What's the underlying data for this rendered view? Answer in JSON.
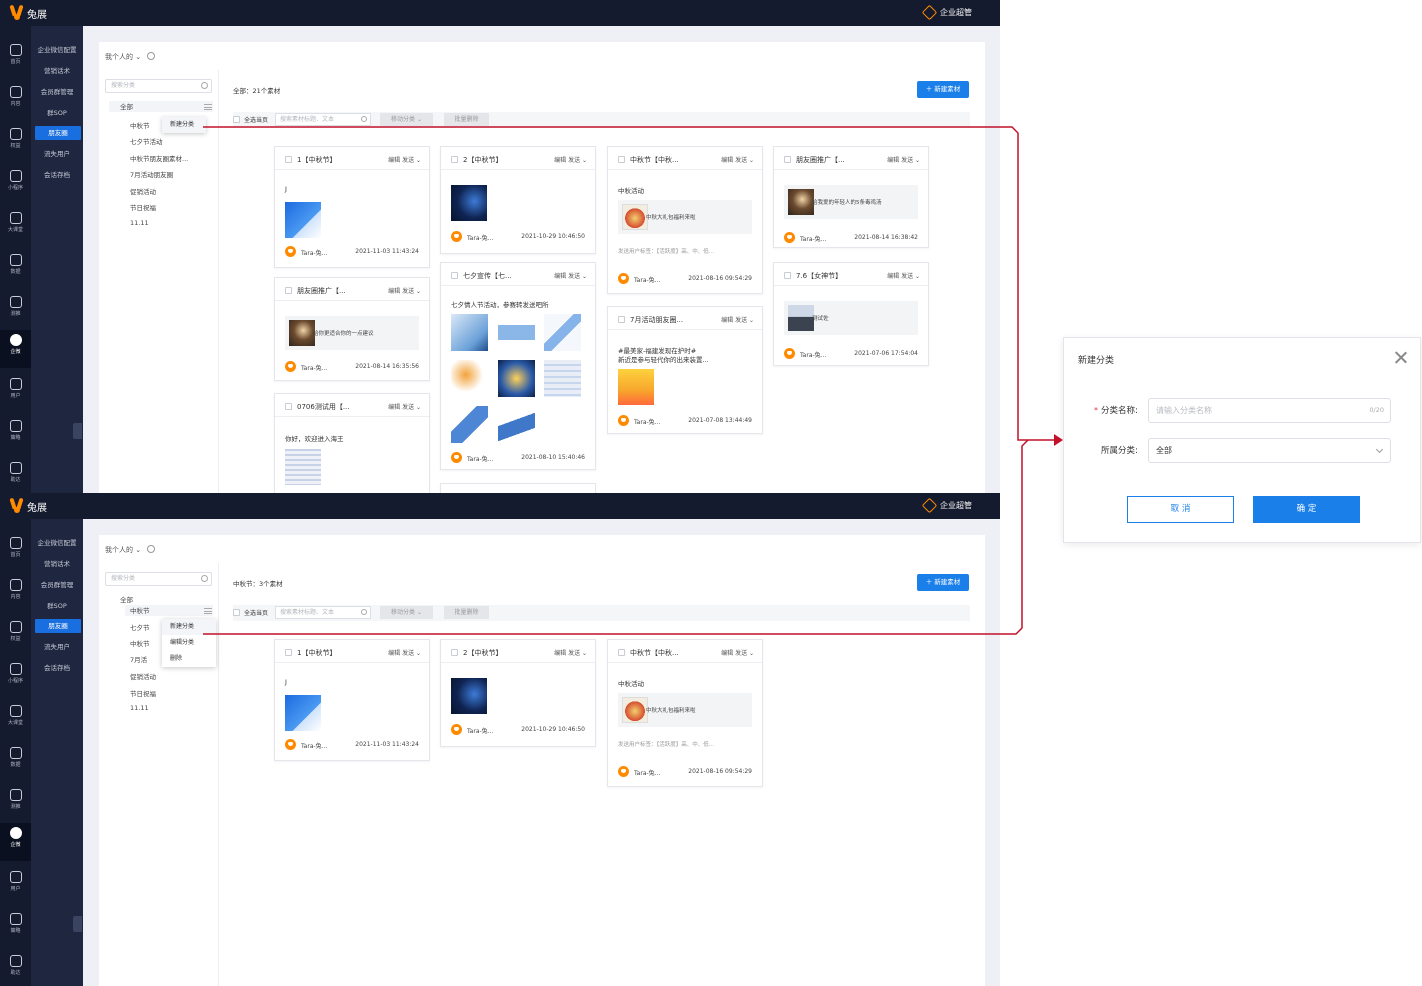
{
  "topbar": {
    "brand": "兔展",
    "enterprise_label": "企业超管"
  },
  "iconbar": [
    {
      "icon": "home-icon",
      "label": "首页"
    },
    {
      "icon": "content-icon",
      "label": "内容"
    },
    {
      "icon": "rights-icon",
      "label": "权益"
    },
    {
      "icon": "miniprogram-icon",
      "label": "小程序"
    },
    {
      "icon": "bigclass-icon",
      "label": "大课堂"
    },
    {
      "icon": "data-icon",
      "label": "数据"
    },
    {
      "icon": "marketing-icon",
      "label": "测推"
    },
    {
      "icon": "wecom-icon",
      "label": "企微"
    },
    {
      "icon": "user-icon",
      "label": "用户"
    },
    {
      "icon": "strategy-icon",
      "label": "策略"
    },
    {
      "icon": "sales-icon",
      "label": "助达"
    }
  ],
  "submenu": [
    {
      "label": "企业微信配置"
    },
    {
      "label": "营销话术"
    },
    {
      "label": "会员群管理"
    },
    {
      "label": "群SOP"
    },
    {
      "label": "朋友圈",
      "active": true
    },
    {
      "label": "流失用户"
    },
    {
      "label": "会话存档"
    }
  ],
  "panel": {
    "scope": "我个人的",
    "search_placeholder": "搜索分类",
    "new_button": "＋ 新建素材",
    "select_all": "全选当页",
    "material_search_placeholder": "搜索素材标题、文本",
    "move_btn": "移动分类",
    "bulk_delete_btn": "批量删除"
  },
  "screen1": {
    "count": "全部：21个素材",
    "tree": [
      "全部",
      "中秋节",
      "七夕节活动",
      "中秋节朋友圈素材...",
      "7月活动朋友圈",
      "促销活动",
      "节日祝福",
      "11.11"
    ],
    "context_menu": [
      "新建分类"
    ]
  },
  "screen2": {
    "count": "中秋节：3个素材",
    "tree": [
      "全部",
      "中秋节",
      "七夕节",
      "中秋节",
      "7月活",
      "促销活动",
      "节日祝福",
      "11.11"
    ],
    "context_menu": [
      "新建分类",
      "编辑分类",
      "删除"
    ]
  },
  "card_actions": "编辑  发送 ⌄",
  "cards": {
    "c1": {
      "title": "1【中秋节】",
      "text": "J",
      "user": "Tara-兔...",
      "time": "2021-11-03 11:43:24"
    },
    "c2": {
      "title": "2【中秋节】",
      "user": "Tara-兔...",
      "time": "2021-10-29 10:46:50"
    },
    "c3": {
      "title": "中秋节【中秋...",
      "text": "中秋活动",
      "link": "中秋大礼包福利来啦",
      "tags": "发送用户标签：【活跃度】高、中、低...",
      "user": "Tara-兔...",
      "time": "2021-08-16 09:54:29"
    },
    "c4": {
      "title": "朋友圈推广【...",
      "link": "给我爱的年轻人的5条毒鸡汤",
      "user": "Tara-兔...",
      "time": "2021-08-14 16:38:42"
    },
    "c5": {
      "title": "朋友圈推广【...",
      "link": "给你更适合你的一点建议",
      "user": "Tara-兔...",
      "time": "2021-08-14 16:35:56"
    },
    "c6": {
      "title": "七夕宣传【七...",
      "text": "七夕情人节活动，参赛转发送吧所",
      "user": "Tara-兔...",
      "time": "2021-08-10 15:40:46"
    },
    "c7": {
      "title": "7月活动朋友圈...",
      "text": "#最美家-福建发现在护时#",
      "text2": "新近是参与轻代你的出来装置...",
      "user": "Tara-兔...",
      "time": "2021-07-08 13:44:49"
    },
    "c8": {
      "title": "7.6【女神节】",
      "link": "测试佐",
      "user": "Tara-兔...",
      "time": "2021-07-06 17:54:04"
    },
    "c9": {
      "title": "0706测试用【...",
      "text": "你好，欢迎进入海王"
    }
  },
  "dialog": {
    "title": "新建分类",
    "required_mark": "*",
    "name_label": "分类名称:",
    "name_placeholder": "请输入分类名称",
    "name_count": "0/20",
    "parent_label": "所属分类:",
    "parent_value": "全部",
    "cancel": "取 消",
    "confirm": "确 定"
  },
  "colors": {
    "primary": "#1a7fe8",
    "dark_nav": "#151b2e",
    "accent": "#ff8a00",
    "connector": "#c4112b"
  }
}
